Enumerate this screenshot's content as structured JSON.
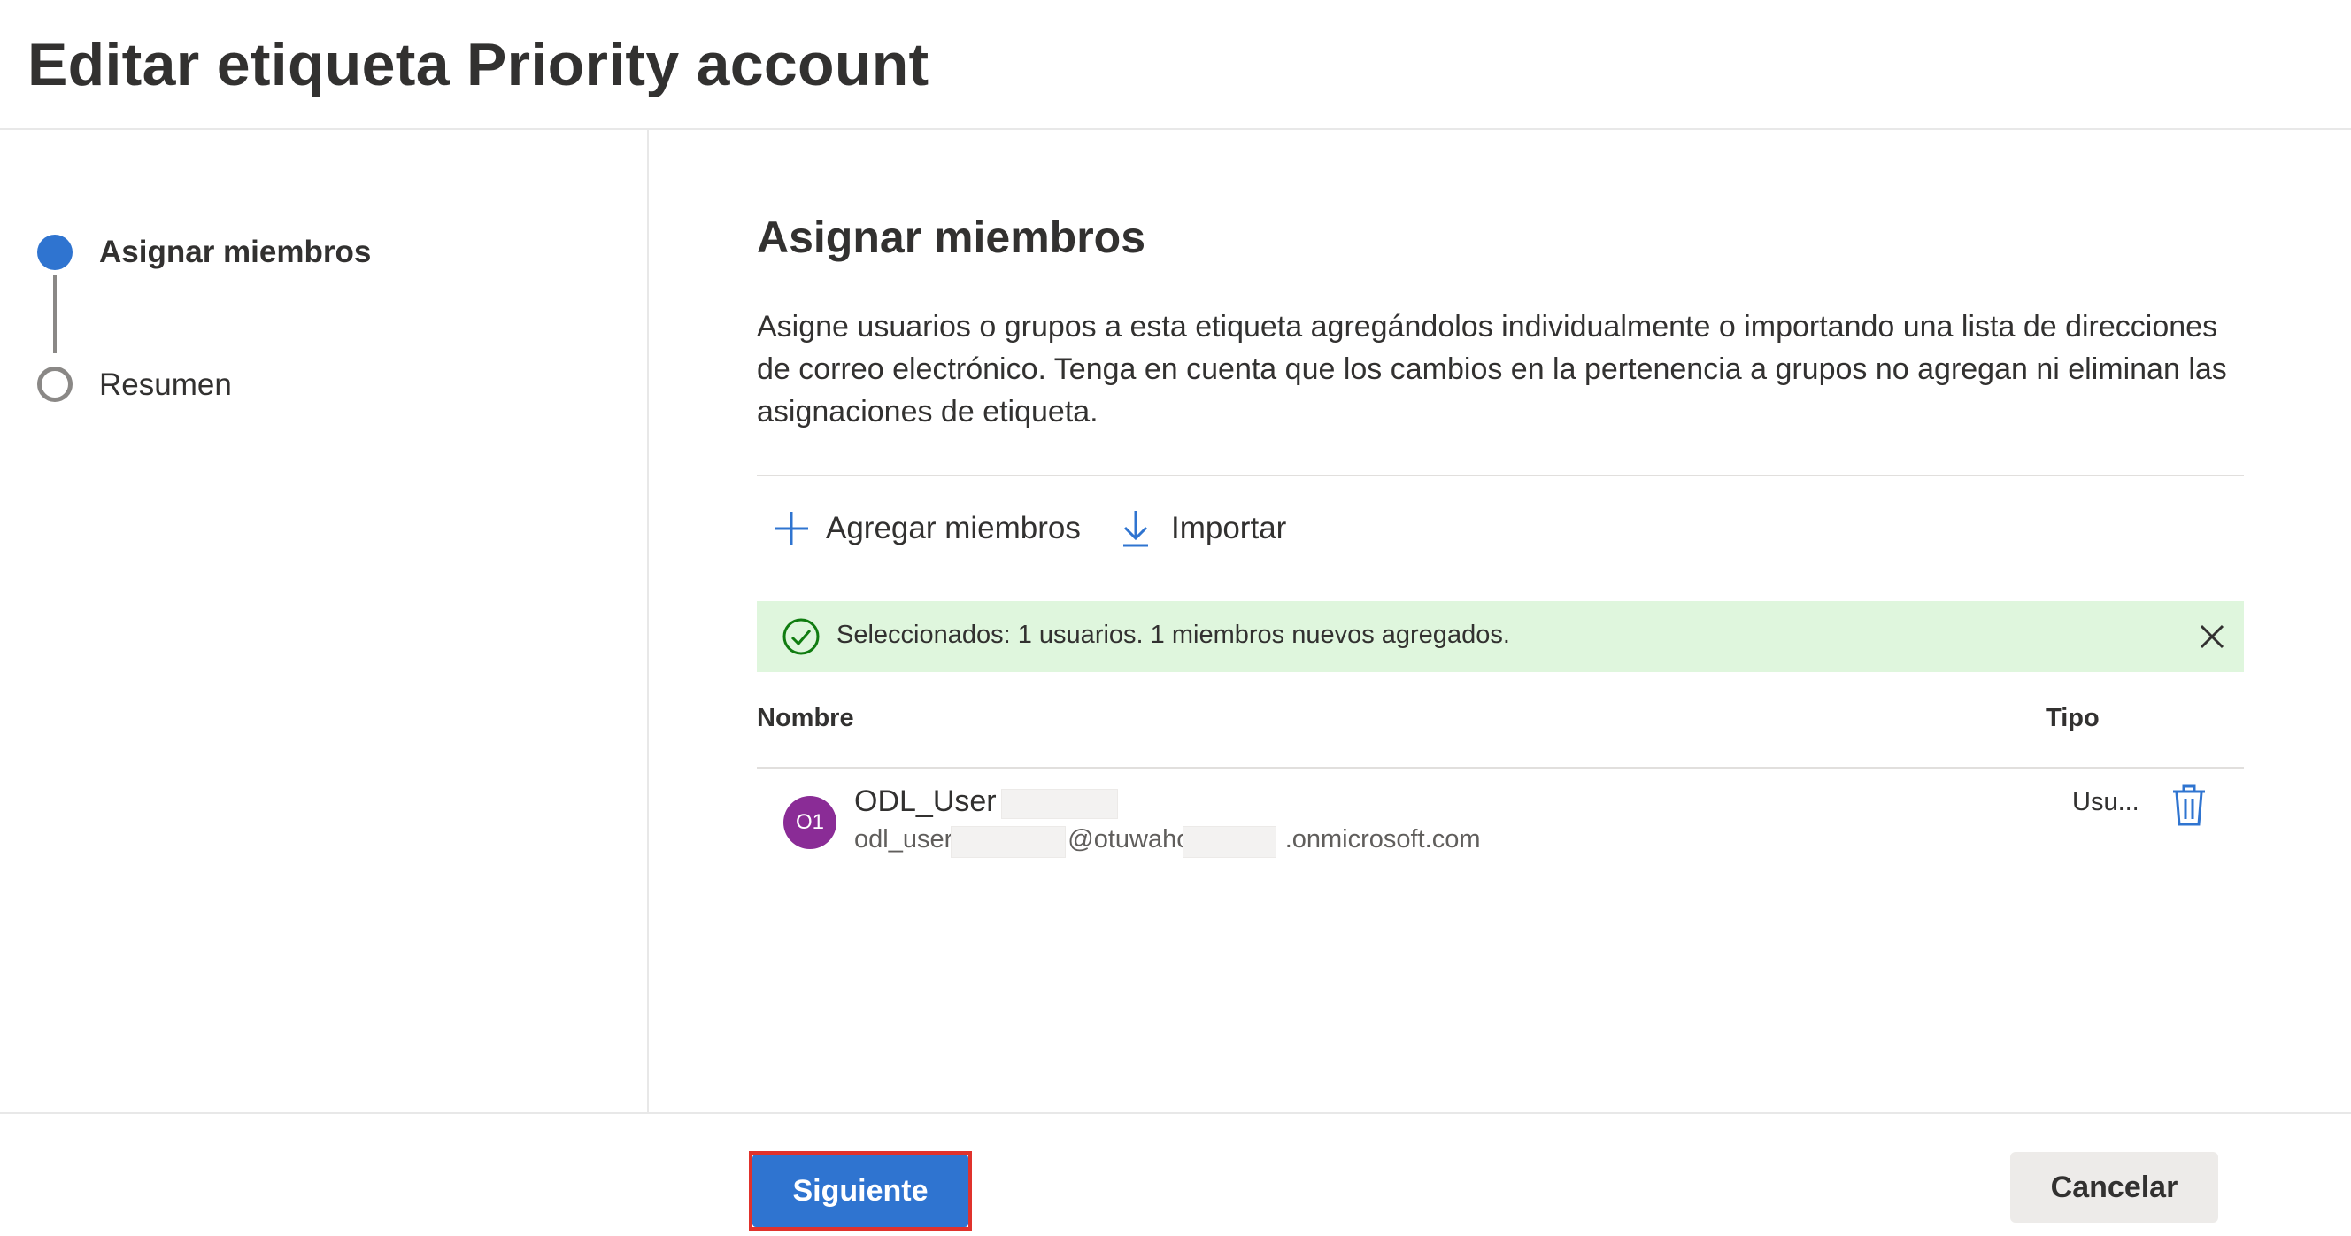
{
  "header": {
    "title": "Editar etiqueta Priority account"
  },
  "steps": [
    {
      "label": "Asignar miembros",
      "state": "active"
    },
    {
      "label": "Resumen",
      "state": "pending"
    }
  ],
  "main": {
    "title": "Asignar miembros",
    "description": "Asigne usuarios o grupos a esta etiqueta agregándolos individualmente o importando una lista de direcciones de correo electrónico. Tenga en cuenta que los cambios en la pertenencia a grupos no agregan ni eliminan las asignaciones de etiqueta.",
    "commands": {
      "add_label": "Agregar miembros",
      "add_icon": "plus-icon",
      "import_label": "Importar",
      "import_icon": "download-arrow-icon"
    },
    "banner": {
      "text": "Seleccionados: 1 usuarios. 1 miembros nuevos agregados.",
      "icon": "checkmark-circle-icon",
      "close_icon": "close-icon",
      "color": "#dff6dd"
    },
    "table": {
      "columns": [
        "Nombre",
        "Tipo"
      ],
      "rows": [
        {
          "initials": "O1",
          "name": "ODL_User",
          "email_part1": "odl_user",
          "email_part2": "@otuwahc",
          "email_part3": ".onmicrosoft.com",
          "type": "Usu...",
          "avatar_color": "#8a2c96"
        }
      ]
    }
  },
  "footer": {
    "next_label": "Siguiente",
    "cancel_label": "Cancelar"
  },
  "colors": {
    "accent": "#2f74d0",
    "highlight_outline": "#e0322c"
  }
}
